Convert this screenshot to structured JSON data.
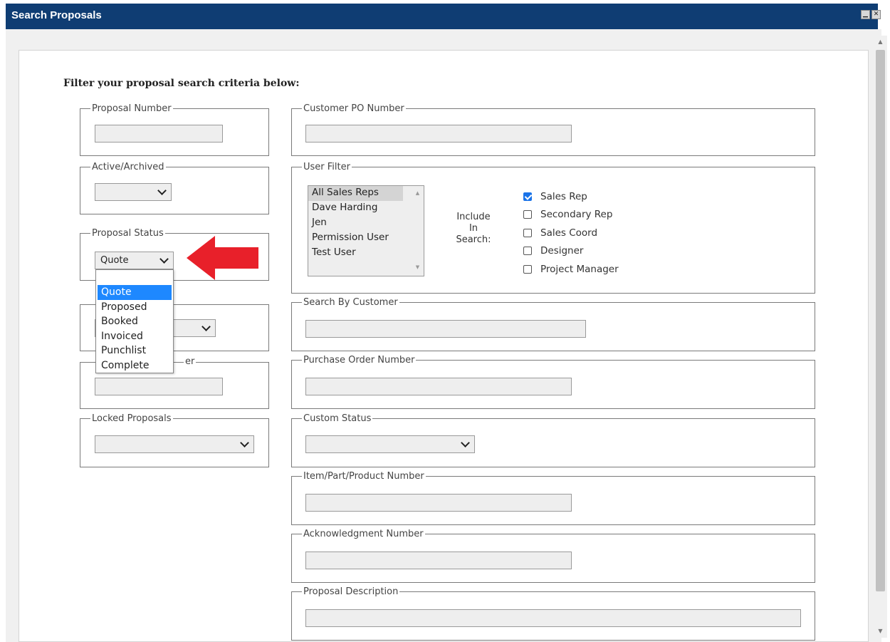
{
  "window": {
    "title": "Search Proposals",
    "buttons": [
      "minimize",
      "close"
    ]
  },
  "heading": "Filter your proposal search criteria below:",
  "groups": {
    "proposal_number": {
      "legend": "Proposal Number",
      "value": ""
    },
    "active_archived": {
      "legend": "Active/Archived",
      "value": ""
    },
    "proposal_status": {
      "legend": "Proposal Status",
      "value": "Quote"
    },
    "hidden_select_group": {
      "legend": "",
      "value": ""
    },
    "hidden_text_group": {
      "legend_suffix": "er",
      "value": ""
    },
    "locked_proposals": {
      "legend": "Locked Proposals",
      "value": ""
    },
    "customer_po_number": {
      "legend": "Customer PO Number",
      "value": ""
    },
    "user_filter": {
      "legend": "User Filter",
      "users": [
        "All Sales Reps",
        "Dave Harding",
        "Jen",
        "Permission User",
        "Test User"
      ],
      "selected_user": "All Sales Reps",
      "include_label": [
        "Include",
        "In",
        "Search:"
      ],
      "roles": [
        {
          "label": "Sales Rep",
          "checked": true
        },
        {
          "label": "Secondary Rep",
          "checked": false
        },
        {
          "label": "Sales Coord",
          "checked": false
        },
        {
          "label": "Designer",
          "checked": false
        },
        {
          "label": "Project Manager",
          "checked": false
        }
      ]
    },
    "search_by_customer": {
      "legend": "Search By Customer",
      "value": ""
    },
    "purchase_order_number": {
      "legend": "Purchase Order Number",
      "value": ""
    },
    "custom_status": {
      "legend": "Custom Status",
      "value": ""
    },
    "item_part_product_number": {
      "legend": "Item/Part/Product Number",
      "value": ""
    },
    "acknowledgment_number": {
      "legend": "Acknowledgment Number",
      "value": ""
    },
    "proposal_description": {
      "legend": "Proposal Description",
      "value": ""
    }
  },
  "status_dropdown": {
    "options": [
      "Quote",
      "Proposed",
      "Booked",
      "Invoiced",
      "Punchlist",
      "Complete"
    ],
    "highlighted": "Quote"
  },
  "annotation": {
    "arrow_color": "#e8202a"
  },
  "colors": {
    "titlebar": "#0f3d73",
    "highlight": "#1e88ff",
    "checkbox": "#1a73e8"
  }
}
